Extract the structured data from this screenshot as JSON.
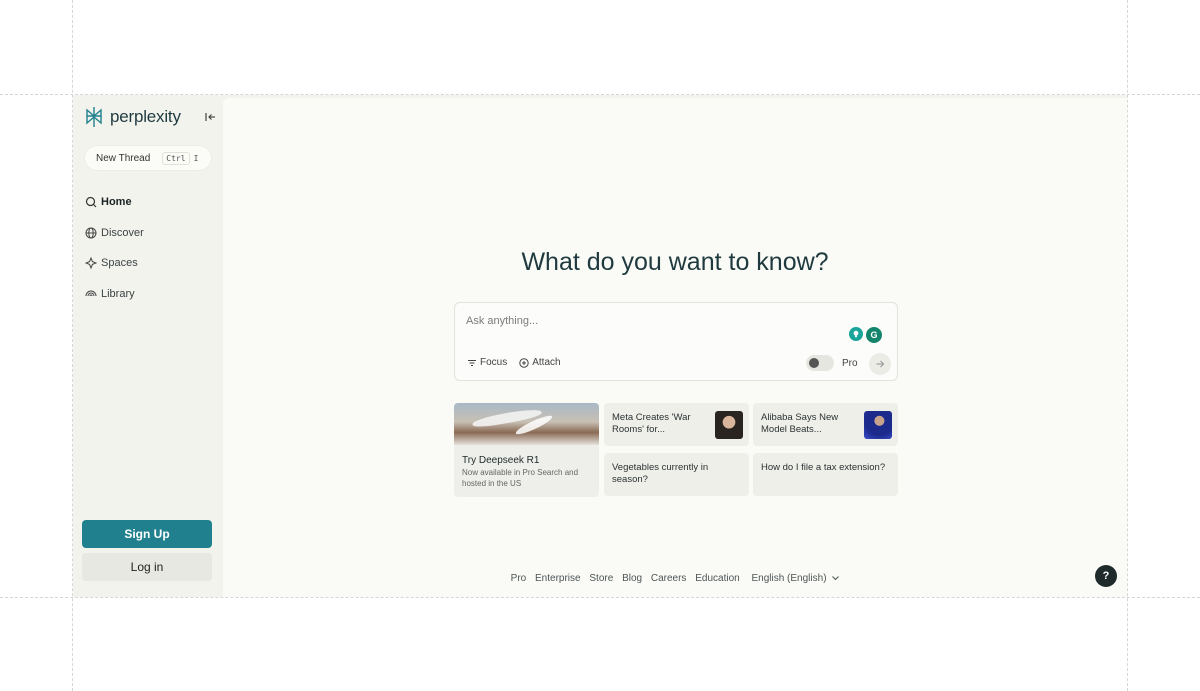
{
  "brand": {
    "name": "perplexity",
    "accent": "#20808d"
  },
  "sidebar": {
    "new_thread": {
      "label": "New Thread",
      "shortcut_key1": "Ctrl",
      "shortcut_key2": "I"
    },
    "items": [
      {
        "label": "Home",
        "icon": "search-icon",
        "active": true
      },
      {
        "label": "Discover",
        "icon": "globe-icon",
        "active": false
      },
      {
        "label": "Spaces",
        "icon": "spaces-icon",
        "active": false
      },
      {
        "label": "Library",
        "icon": "library-icon",
        "active": false
      }
    ],
    "signup_label": "Sign Up",
    "login_label": "Log in"
  },
  "main": {
    "headline": "What do you want to know?",
    "search": {
      "placeholder": "Ask anything...",
      "focus_label": "Focus",
      "attach_label": "Attach",
      "pro_label": "Pro",
      "ext_icon_b": "G"
    },
    "cards": {
      "feature": {
        "title": "Try Deepseek R1",
        "subtitle": "Now available in Pro Search and hosted in the US"
      },
      "small": [
        "Meta Creates 'War Rooms' for...",
        "Alibaba Says New Model Beats...",
        "Vegetables currently in season?",
        "How do I file a tax extension?"
      ]
    },
    "footer": [
      "Pro",
      "Enterprise",
      "Store",
      "Blog",
      "Careers",
      "Education",
      "English (English)"
    ],
    "help_label": "?"
  }
}
